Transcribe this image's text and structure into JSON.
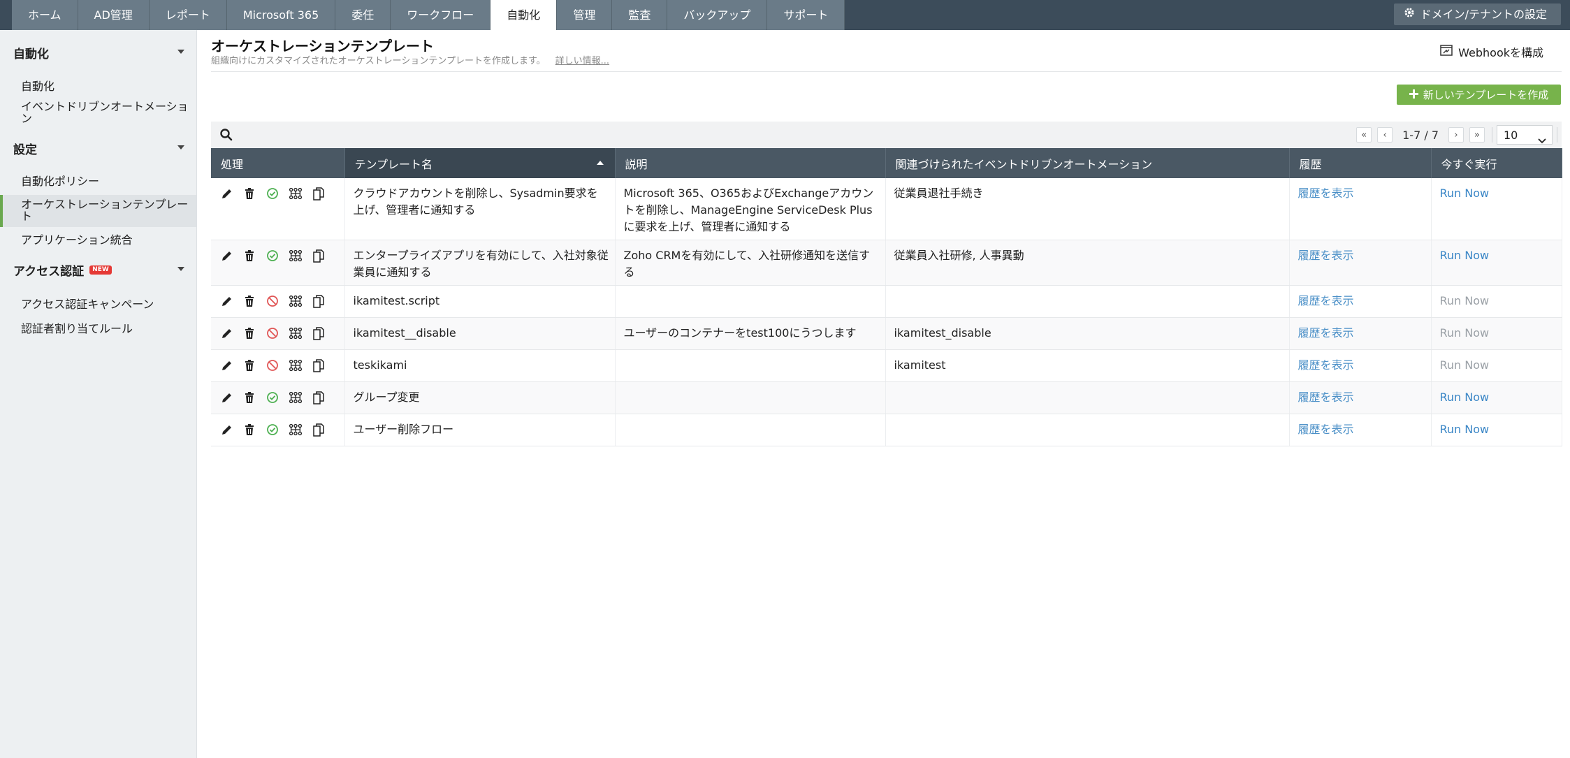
{
  "nav": {
    "tabs": [
      {
        "label": "ホーム",
        "active": false
      },
      {
        "label": "AD管理",
        "active": false
      },
      {
        "label": "レポート",
        "active": false
      },
      {
        "label": "Microsoft 365",
        "active": false
      },
      {
        "label": "委任",
        "active": false
      },
      {
        "label": "ワークフロー",
        "active": false
      },
      {
        "label": "自動化",
        "active": true
      },
      {
        "label": "管理",
        "active": false
      },
      {
        "label": "監査",
        "active": false
      },
      {
        "label": "バックアップ",
        "active": false
      },
      {
        "label": "サポート",
        "active": false
      }
    ],
    "domain_settings": "ドメイン/テナントの設定"
  },
  "sidebar": {
    "sections": [
      {
        "title": "自動化",
        "items": [
          "自動化",
          "イベントドリブンオートメーション"
        ]
      },
      {
        "title": "設定",
        "items": [
          "自動化ポリシー",
          "オーケストレーションテンプレート",
          "アプリケーション統合"
        ]
      },
      {
        "title": "アクセス認証",
        "badge": "NEW",
        "items": [
          "アクセス認証キャンペーン",
          "認証者割り当てルール"
        ]
      }
    ],
    "active_item": "オーケストレーションテンプレート"
  },
  "main": {
    "title": "オーケストレーションテンプレート",
    "subtitle": "組織向けにカスタマイズされたオーケストレーションテンプレートを作成します。",
    "more_link": "詳しい情報...",
    "webhook": "Webhookを構成",
    "new_template": "新しいテンプレートを作成",
    "pager": {
      "info": "1-7 / 7",
      "page_size": "10"
    },
    "columns": [
      "処理",
      "テンプレート名",
      "説明",
      "関連づけられたイベントドリブンオートメーション",
      "履歴",
      "今すぐ実行"
    ],
    "rows": [
      {
        "name": "クラウドアカウントを削除し、Sysadmin要求を上げ、管理者に通知する",
        "description": "Microsoft 365、O365およびExchangeアカウントを削除し、ManageEngine ServiceDesk Plusに要求を上げ、管理者に通知する",
        "automation": "従業員退社手続き",
        "enabled": true,
        "history": "履歴を表示",
        "run": "Run Now"
      },
      {
        "name": "エンタープライズアプリを有効にして、入社対象従業員に通知する",
        "description": "Zoho CRMを有効にして、入社研修通知を送信する",
        "automation": "従業員入社研修, 人事異動",
        "enabled": true,
        "history": "履歴を表示",
        "run": "Run Now"
      },
      {
        "name": "ikamitest.script",
        "description": "",
        "automation": "",
        "enabled": false,
        "history": "履歴を表示",
        "run": "Run Now"
      },
      {
        "name": "ikamitest__disable",
        "description": "ユーザーのコンテナーをtest100にうつします",
        "automation": "ikamitest_disable",
        "enabled": false,
        "history": "履歴を表示",
        "run": "Run Now"
      },
      {
        "name": "teskikami",
        "description": "",
        "automation": "ikamitest",
        "enabled": false,
        "history": "履歴を表示",
        "run": "Run Now"
      },
      {
        "name": "グループ変更",
        "description": "",
        "automation": "",
        "enabled": true,
        "history": "履歴を表示",
        "run": "Run Now"
      },
      {
        "name": "ユーザー削除フロー",
        "description": "",
        "automation": "",
        "enabled": true,
        "history": "履歴を表示",
        "run": "Run Now"
      }
    ]
  },
  "icons": {
    "edit": "pencil-icon",
    "delete": "trash-icon",
    "enabled": "check-circle-icon",
    "disabled": "ban-icon",
    "workflow": "workflow-icon",
    "copy": "copy-icon",
    "search": "search-icon"
  },
  "colors": {
    "accent_green": "#77b34b",
    "link_blue": "#4a8fc7",
    "enabled_green": "#4caf50",
    "disabled_red": "#e05555"
  }
}
